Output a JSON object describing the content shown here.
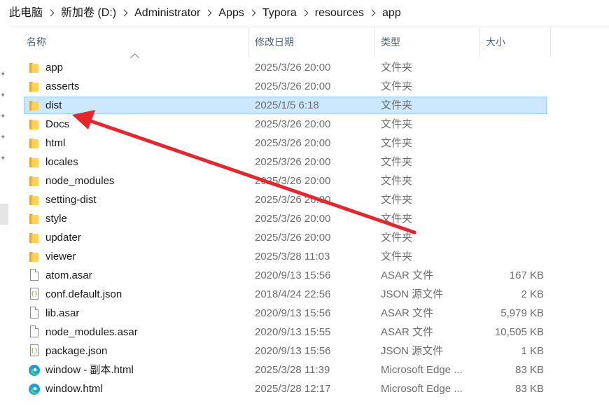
{
  "breadcrumb": [
    "此电脑",
    "新加卷 (D:)",
    "Administrator",
    "Apps",
    "Typora",
    "resources",
    "app"
  ],
  "columns": {
    "name": "名称",
    "date": "修改日期",
    "type": "类型",
    "size": "大小"
  },
  "files": [
    {
      "name": "app",
      "date": "2025/3/26 20:00",
      "type": "文件夹",
      "size": "",
      "icon": "folder-icon"
    },
    {
      "name": "asserts",
      "date": "2025/3/26 20:00",
      "type": "文件夹",
      "size": "",
      "icon": "folder-icon"
    },
    {
      "name": "dist",
      "date": "2025/1/5 6:18",
      "type": "文件夹",
      "size": "",
      "icon": "folder-icon",
      "selected": true
    },
    {
      "name": "Docs",
      "date": "2025/3/26 20:00",
      "type": "文件夹",
      "size": "",
      "icon": "folder-icon"
    },
    {
      "name": "html",
      "date": "2025/3/26 20:00",
      "type": "文件夹",
      "size": "",
      "icon": "folder-icon"
    },
    {
      "name": "locales",
      "date": "2025/3/26 20:00",
      "type": "文件夹",
      "size": "",
      "icon": "folder-icon"
    },
    {
      "name": "node_modules",
      "date": "2025/3/26 20:00",
      "type": "文件夹",
      "size": "",
      "icon": "folder-icon"
    },
    {
      "name": "setting-dist",
      "date": "2025/3/26 20:00",
      "type": "文件夹",
      "size": "",
      "icon": "folder-icon"
    },
    {
      "name": "style",
      "date": "2025/3/26 20:00",
      "type": "文件夹",
      "size": "",
      "icon": "folder-icon"
    },
    {
      "name": "updater",
      "date": "2025/3/26 20:00",
      "type": "文件夹",
      "size": "",
      "icon": "folder-icon"
    },
    {
      "name": "viewer",
      "date": "2025/3/28 11:03",
      "type": "文件夹",
      "size": "",
      "icon": "folder-icon"
    },
    {
      "name": "atom.asar",
      "date": "2020/9/13 15:56",
      "type": "ASAR 文件",
      "size": "167 KB",
      "icon": "file-icon"
    },
    {
      "name": "conf.default.json",
      "date": "2018/4/24 22:56",
      "type": "JSON 源文件",
      "size": "2 KB",
      "icon": "json-file-icon"
    },
    {
      "name": "lib.asar",
      "date": "2020/9/13 15:56",
      "type": "ASAR 文件",
      "size": "5,979 KB",
      "icon": "file-icon"
    },
    {
      "name": "node_modules.asar",
      "date": "2020/9/13 15:55",
      "type": "ASAR 文件",
      "size": "10,505 KB",
      "icon": "file-icon"
    },
    {
      "name": "package.json",
      "date": "2020/9/13 15:56",
      "type": "JSON 源文件",
      "size": "1 KB",
      "icon": "json-file-icon"
    },
    {
      "name": "window - 副本.html",
      "date": "2025/3/28 11:39",
      "type": "Microsoft Edge ...",
      "size": "83 KB",
      "icon": "edge-icon"
    },
    {
      "name": "window.html",
      "date": "2025/3/28 12:17",
      "type": "Microsoft Edge ...",
      "size": "83 KB",
      "icon": "edge-icon"
    }
  ],
  "annotation": {
    "color": "#e8252b"
  },
  "colors": {
    "selection_bg": "#cce8ff",
    "selection_border": "#99d1ff",
    "header_text": "#4c607a"
  }
}
